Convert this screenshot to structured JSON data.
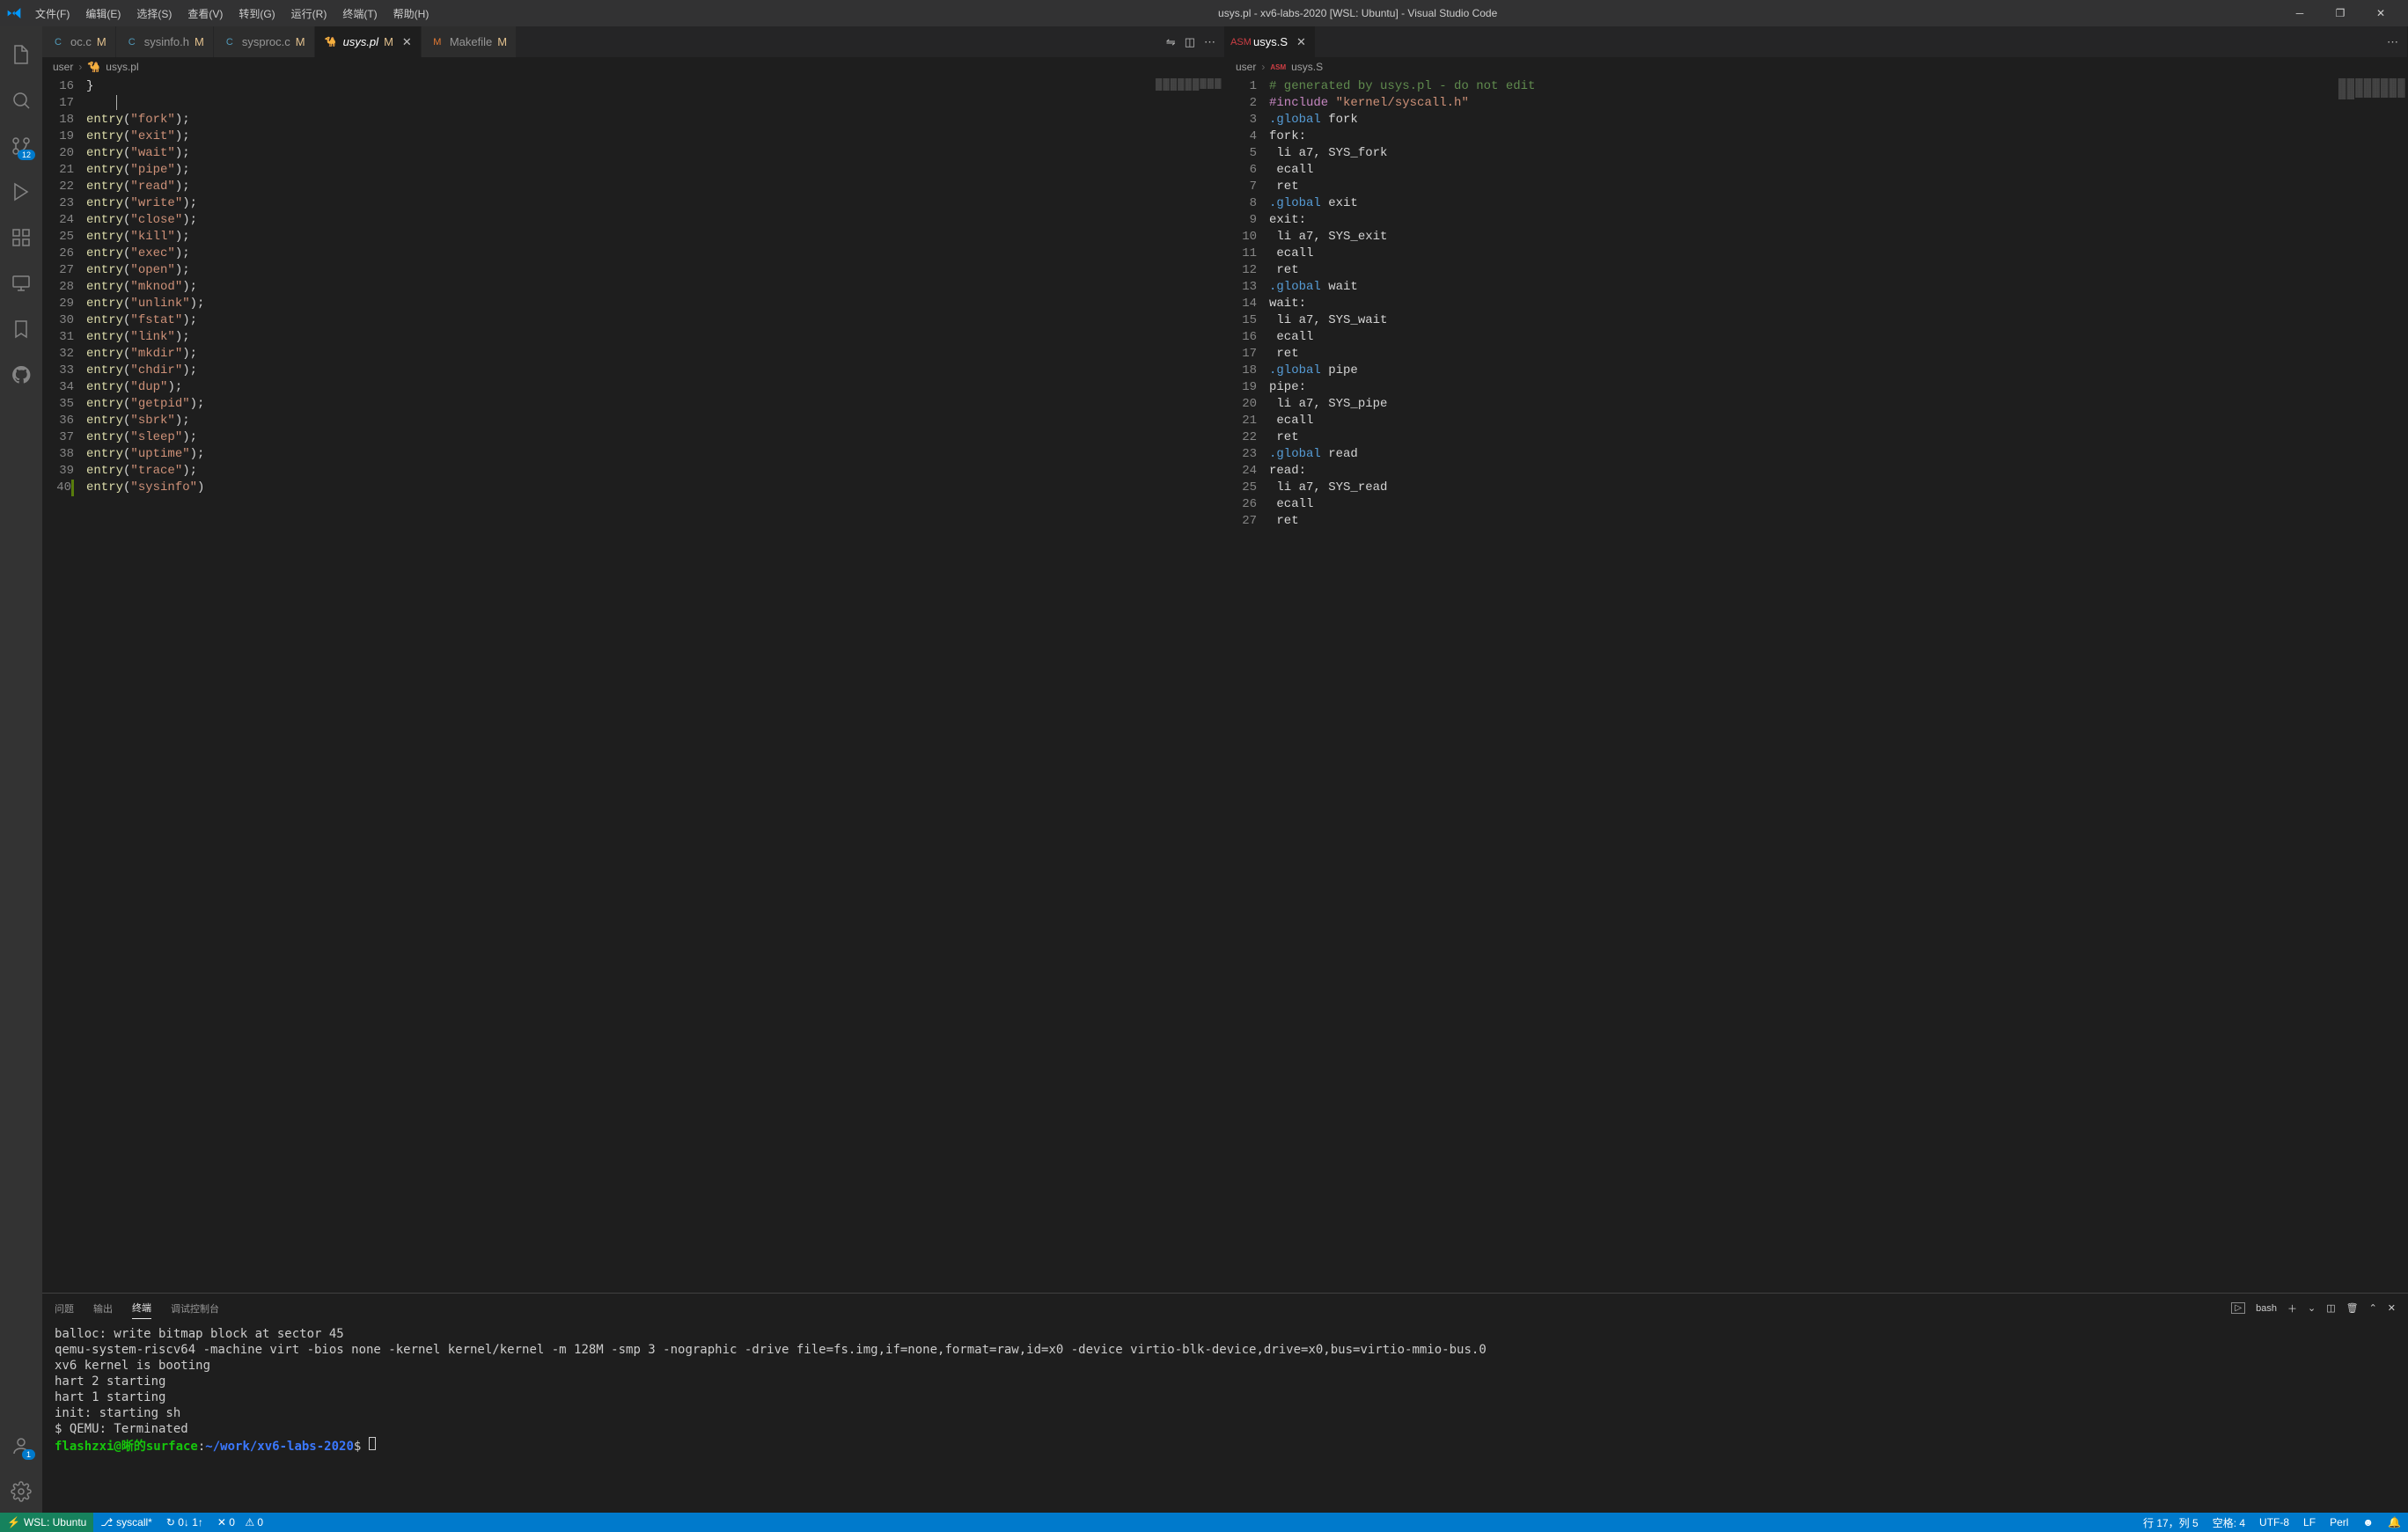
{
  "title": "usys.pl - xv6-labs-2020 [WSL: Ubuntu] - Visual Studio Code",
  "menu": [
    "文件(F)",
    "编辑(E)",
    "选择(S)",
    "查看(V)",
    "转到(G)",
    "运行(R)",
    "终端(T)",
    "帮助(H)"
  ],
  "activity_badge_scm": "12",
  "activity_badge_account": "1",
  "tabs_left": [
    {
      "icon": "C",
      "iconColor": "#519aba",
      "name": "oc.c",
      "mod": "M",
      "active": false
    },
    {
      "icon": "C",
      "iconColor": "#519aba",
      "name": "sysinfo.h",
      "mod": "M",
      "active": false
    },
    {
      "icon": "C",
      "iconColor": "#519aba",
      "name": "sysproc.c",
      "mod": "M",
      "active": false
    },
    {
      "icon": "🐪",
      "iconColor": "#b58e4f",
      "name": "usys.pl",
      "mod": "M",
      "active": true,
      "italic": true
    },
    {
      "icon": "M",
      "iconColor": "#e37933",
      "name": "Makefile",
      "mod": "M",
      "active": false
    }
  ],
  "tabs_right": [
    {
      "icon": "ASM",
      "iconColor": "#cc3e44",
      "name": "usys.S",
      "active": true
    }
  ],
  "breadcrumb_left": [
    "user",
    "usys.pl"
  ],
  "breadcrumb_right": [
    "user",
    "usys.S"
  ],
  "left_start_line": 16,
  "left_lines": [
    {
      "raw": "}"
    },
    {
      "raw": "",
      "cursor": true
    },
    {
      "entry": "fork"
    },
    {
      "entry": "exit"
    },
    {
      "entry": "wait"
    },
    {
      "entry": "pipe"
    },
    {
      "entry": "read"
    },
    {
      "entry": "write"
    },
    {
      "entry": "close"
    },
    {
      "entry": "kill"
    },
    {
      "entry": "exec"
    },
    {
      "entry": "open"
    },
    {
      "entry": "mknod"
    },
    {
      "entry": "unlink"
    },
    {
      "entry": "fstat"
    },
    {
      "entry": "link"
    },
    {
      "entry": "mkdir"
    },
    {
      "entry": "chdir"
    },
    {
      "entry": "dup"
    },
    {
      "entry": "getpid"
    },
    {
      "entry": "sbrk"
    },
    {
      "entry": "sleep"
    },
    {
      "entry": "uptime"
    },
    {
      "entry": "trace"
    },
    {
      "entry": "sysinfo",
      "nosemi": true,
      "modified": true
    }
  ],
  "right_lines": [
    {
      "t": "cmt",
      "txt": "# generated by usys.pl - do not edit"
    },
    {
      "t": "inc",
      "txt": "#include \"kernel/syscall.h\""
    },
    {
      "t": "glb",
      "name": "fork"
    },
    {
      "t": "lbl",
      "name": "fork"
    },
    {
      "t": "ins",
      "txt": " li a7, SYS_fork"
    },
    {
      "t": "ins",
      "txt": " ecall"
    },
    {
      "t": "ins",
      "txt": " ret"
    },
    {
      "t": "glb",
      "name": "exit"
    },
    {
      "t": "lbl",
      "name": "exit"
    },
    {
      "t": "ins",
      "txt": " li a7, SYS_exit"
    },
    {
      "t": "ins",
      "txt": " ecall"
    },
    {
      "t": "ins",
      "txt": " ret"
    },
    {
      "t": "glb",
      "name": "wait"
    },
    {
      "t": "lbl",
      "name": "wait"
    },
    {
      "t": "ins",
      "txt": " li a7, SYS_wait"
    },
    {
      "t": "ins",
      "txt": " ecall"
    },
    {
      "t": "ins",
      "txt": " ret"
    },
    {
      "t": "glb",
      "name": "pipe"
    },
    {
      "t": "lbl",
      "name": "pipe"
    },
    {
      "t": "ins",
      "txt": " li a7, SYS_pipe"
    },
    {
      "t": "ins",
      "txt": " ecall"
    },
    {
      "t": "ins",
      "txt": " ret"
    },
    {
      "t": "glb",
      "name": "read"
    },
    {
      "t": "lbl",
      "name": "read"
    },
    {
      "t": "ins",
      "txt": " li a7, SYS_read"
    },
    {
      "t": "ins",
      "txt": " ecall"
    },
    {
      "t": "ins",
      "txt": " ret"
    }
  ],
  "panel_tabs": [
    "问题",
    "输出",
    "终端",
    "调试控制台"
  ],
  "panel_active": "终端",
  "panel_shell": "bash",
  "terminal_lines": [
    "balloc: write bitmap block at sector 45",
    "qemu-system-riscv64 -machine virt -bios none -kernel kernel/kernel -m 128M -smp 3 -nographic -drive file=fs.img,if=none,format=raw,id=x0 -device virtio-blk-device,drive=x0,bus=virtio-mmio-bus.0",
    "",
    "xv6 kernel is booting",
    "",
    "hart 2 starting",
    "hart 1 starting",
    "init: starting sh",
    "$ QEMU: Terminated"
  ],
  "terminal_prompt": {
    "user": "flashzxi@晰的surface",
    "path": "~/work/xv6-labs-2020",
    "sym": "$"
  },
  "status": {
    "remote": "WSL: Ubuntu",
    "branch": "syscall*",
    "sync": "↻ 0↓ 1↑",
    "err": "✕ 0",
    "warn": "⚠ 0",
    "pos": "行 17，列 5",
    "spaces": "空格: 4",
    "enc": "UTF-8",
    "eol": "LF",
    "lang": "Perl"
  }
}
